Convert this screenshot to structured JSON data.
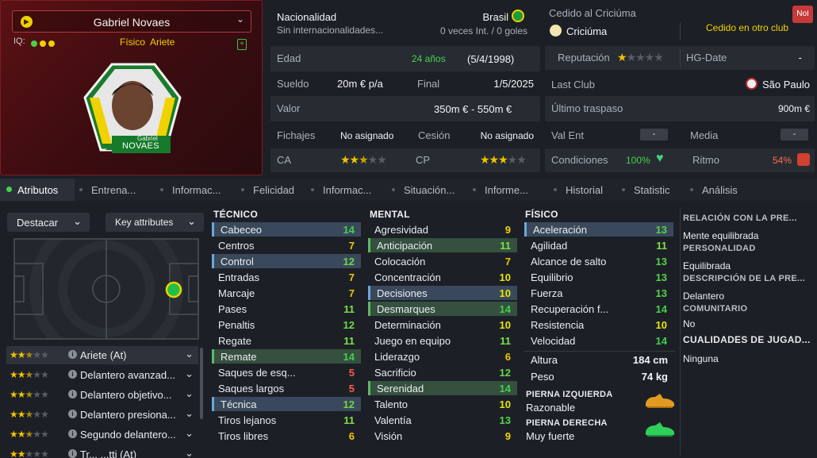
{
  "player": {
    "name": "Gabriel Novaes",
    "iq_label": "IQ:",
    "tags": [
      "Físico",
      "Ariete"
    ],
    "shirt_name_1": "Gabriel",
    "shirt_name_2": "NOVAES"
  },
  "info": {
    "nationality_label": "Nacionalidad",
    "nationality_value": "Brasil",
    "international_label": "Sin internacionalidades...",
    "international_value": "0 veces Int. / 0 goles",
    "age_label": "Edad",
    "age_value": "24 años",
    "birth_date": "(5/4/1998)",
    "wage_label": "Sueldo",
    "wage_value": "20m € p/a",
    "end_label": "Final",
    "end_value": "1/5/2025",
    "value_label": "Valor",
    "value_value": "350m € - 550m €",
    "transfers_label": "Fichajes",
    "transfers_value": "No asignado",
    "loan_label": "Cesión",
    "loan_value": "No asignado",
    "ca_label": "CA",
    "ca_stars": 2.5,
    "cp_label": "CP",
    "cp_stars": 3
  },
  "club": {
    "loaned_label": "Cedido al Criciúma",
    "club_name": "Criciúma",
    "loaned_status": "Cedido en otro club",
    "nol_badge": "NoI",
    "reputation_label": "Reputación",
    "reputation_stars": 1,
    "hg_label": "HG-Date",
    "hg_value": "-",
    "last_club_label": "Last Club",
    "last_club_value": "São Paulo",
    "last_transfer_label": "Último traspaso",
    "last_transfer_value": "900m €",
    "val_ent_label": "Val Ent",
    "val_ent_value": "-",
    "media_label": "Media",
    "media_value": "-",
    "condition_label": "Condiciones",
    "condition_value": "100%",
    "rhythm_label": "Ritmo",
    "rhythm_value": "54%"
  },
  "tabs": [
    "Atributos",
    "Entrena...",
    "Informac...",
    "Felicidad",
    "Informac...",
    "Situación...",
    "Informe...",
    "Historial",
    "Statistic",
    "Análisis"
  ],
  "controls": {
    "highlight_label": "Destacar",
    "key_attributes_label": "Key attributes"
  },
  "roles": [
    {
      "name": "Ariete (At)",
      "stars": 2.5
    },
    {
      "name": "Delantero avanzad...",
      "stars": 2.5
    },
    {
      "name": "Delantero objetivo...",
      "stars": 2.5
    },
    {
      "name": "Delantero presiona...",
      "stars": 2.5
    },
    {
      "name": "Segundo delantero...",
      "stars": 2.5
    },
    {
      "name": "Tr... ...tti (At)",
      "stars": 2
    }
  ],
  "technical": {
    "title": "TÉCNICO",
    "attributes": [
      {
        "name": "Cabeceo",
        "value": 14,
        "hl": "blue"
      },
      {
        "name": "Centros",
        "value": 7
      },
      {
        "name": "Control",
        "value": 12,
        "hl": "blue"
      },
      {
        "name": "Entradas",
        "value": 7
      },
      {
        "name": "Marcaje",
        "value": 7
      },
      {
        "name": "Pases",
        "value": 11
      },
      {
        "name": "Penaltis",
        "value": 12
      },
      {
        "name": "Regate",
        "value": 11
      },
      {
        "name": "Remate",
        "value": 14,
        "hl": "green"
      },
      {
        "name": "Saques de esq...",
        "value": 5
      },
      {
        "name": "Saques largos",
        "value": 5
      },
      {
        "name": "Técnica",
        "value": 12,
        "hl": "blue"
      },
      {
        "name": "Tiros lejanos",
        "value": 11
      },
      {
        "name": "Tiros libres",
        "value": 6
      }
    ]
  },
  "mental": {
    "title": "MENTAL",
    "attributes": [
      {
        "name": "Agresividad",
        "value": 9
      },
      {
        "name": "Anticipación",
        "value": 11,
        "hl": "green"
      },
      {
        "name": "Colocación",
        "value": 7
      },
      {
        "name": "Concentración",
        "value": 10
      },
      {
        "name": "Decisiones",
        "value": 10,
        "hl": "blue"
      },
      {
        "name": "Desmarques",
        "value": 14,
        "hl": "green"
      },
      {
        "name": "Determinación",
        "value": 10
      },
      {
        "name": "Juego en equipo",
        "value": 11
      },
      {
        "name": "Liderazgo",
        "value": 6
      },
      {
        "name": "Sacrificio",
        "value": 12
      },
      {
        "name": "Serenidad",
        "value": 14,
        "hl": "green"
      },
      {
        "name": "Talento",
        "value": 10
      },
      {
        "name": "Valentía",
        "value": 13
      },
      {
        "name": "Visión",
        "value": 9
      }
    ]
  },
  "physical": {
    "title": "FÍSICO",
    "attributes": [
      {
        "name": "Aceleración",
        "value": 13,
        "hl": "blue"
      },
      {
        "name": "Agilidad",
        "value": 11
      },
      {
        "name": "Alcance de salto",
        "value": 13
      },
      {
        "name": "Equilibrio",
        "value": 13
      },
      {
        "name": "Fuerza",
        "value": 13
      },
      {
        "name": "Recuperación f...",
        "value": 14
      },
      {
        "name": "Resistencia",
        "value": 10
      },
      {
        "name": "Velocidad",
        "value": 14
      }
    ],
    "height_label": "Altura",
    "height_value": "184 cm",
    "weight_label": "Peso",
    "weight_value": "74 kg",
    "left_foot_label": "PIERNA IZQUIERDA",
    "left_foot_value": "Razonable",
    "right_foot_label": "PIERNA DERECHA",
    "right_foot_value": "Muy fuerte"
  },
  "sidebar": {
    "media_relation_label": "RELACIÓN CON LA PRE...",
    "media_relation_value": "Mente equilibrada",
    "personality_label": "PERSONALIDAD",
    "personality_value": "Equilibrada",
    "description_label": "DESCRIPCIÓN DE LA PRE...",
    "description_value": "Delantero",
    "community_label": "COMUNITARIO",
    "community_value": "No",
    "qualities_label": "CUALIDADES DE JUGAD...",
    "qualities_value": "Ninguna"
  },
  "colors": {
    "accent": "#6da6d8",
    "green": "#47d14a",
    "card_red": "#5b1114"
  }
}
